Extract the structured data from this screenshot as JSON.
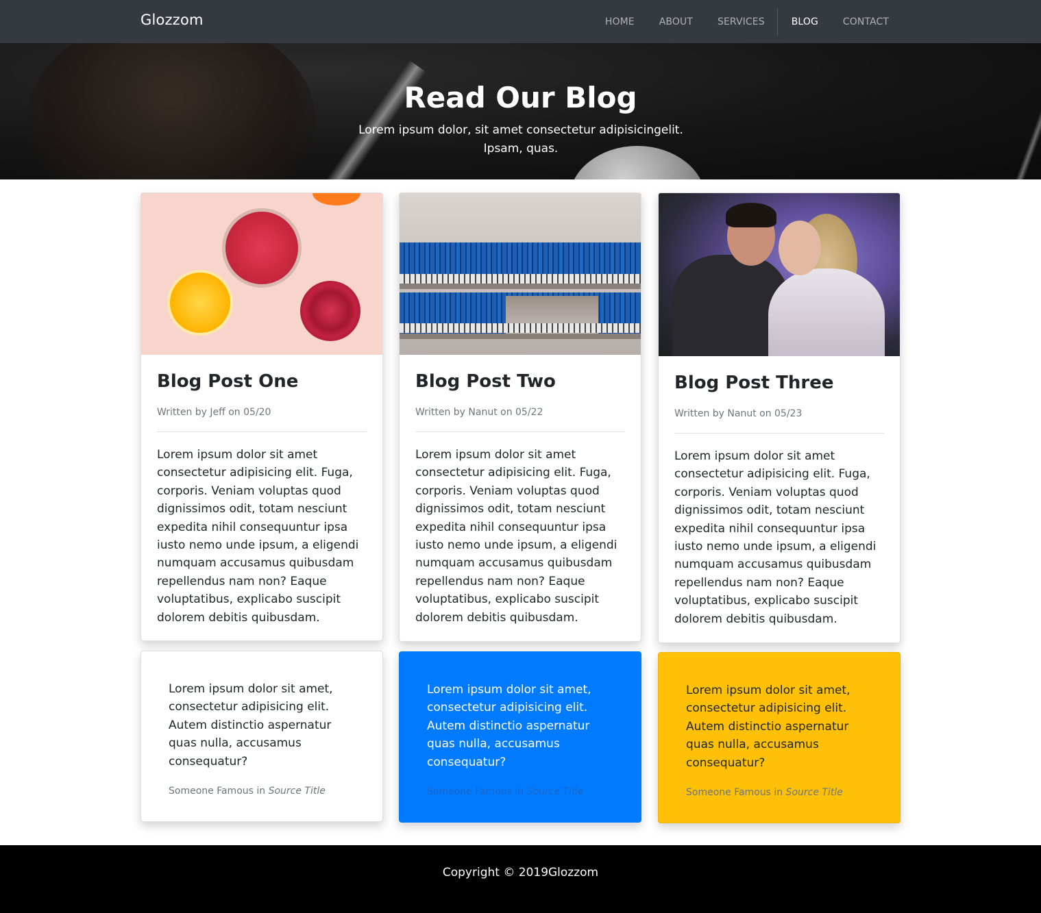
{
  "navbar": {
    "brand": "Glozzom",
    "links": [
      {
        "label": "HOME",
        "active": false
      },
      {
        "label": "ABOUT",
        "active": false
      },
      {
        "label": "SERVICES",
        "active": false
      },
      {
        "label": "BLOG",
        "active": true
      },
      {
        "label": "CONTACT",
        "active": false
      }
    ]
  },
  "hero": {
    "title": "Read Our Blog",
    "subtitle": "Lorem ipsum dolor, sit amet consectetur adipisicingelit. Ipsam, quas."
  },
  "posts": [
    {
      "title": "Blog Post One",
      "meta": "Written by Jeff on 05/20",
      "image": "fruits-photo",
      "body": "Lorem ipsum dolor sit amet consectetur adipisicing elit. Fuga, corporis. Veniam voluptas quod dignissimos odit, totam nesciunt expedita nihil consequuntur ipsa iusto nemo unde ipsum, a eligendi numquam accusamus quibusdam repellendus nam non? Eaque voluptatibus, explicabo suscipit dolorem debitis quibusdam."
    },
    {
      "title": "Blog Post Two",
      "meta": "Written by Nanut on 05/22",
      "image": "library-photo",
      "body": "Lorem ipsum dolor sit amet consectetur adipisicing elit. Fuga, corporis. Veniam voluptas quod dignissimos odit, totam nesciunt expedita nihil consequuntur ipsa iusto nemo unde ipsum, a eligendi numquam accusamus quibusdam repellendus nam non? Eaque voluptatibus, explicabo suscipit dolorem debitis quibusdam."
    },
    {
      "title": "Blog Post Three",
      "meta": "Written by Nanut on 05/23",
      "image": "couple-photo",
      "body": "Lorem ipsum dolor sit amet consectetur adipisicing elit. Fuga, corporis. Veniam voluptas quod dignissimos odit, totam nesciunt expedita nihil consequuntur ipsa iusto nemo unde ipsum, a eligendi numquam accusamus quibusdam repellendus nam non? Eaque voluptatibus, explicabo suscipit dolorem debitis quibusdam."
    }
  ],
  "quotes": [
    {
      "text": "Lorem ipsum dolor sit amet, consectetur adipisicing elit. Autem distinctio aspernatur quas nulla, accusamus consequatur?",
      "author": "Someone Famous in",
      "source": "Source Title",
      "color": "#ffffff"
    },
    {
      "text": "Lorem ipsum dolor sit amet, consectetur adipisicing elit. Autem distinctio aspernatur quas nulla, accusamus consequatur?",
      "author": "Someone Famous in",
      "source": "Source Title",
      "color": "#007bff"
    },
    {
      "text": "Lorem ipsum dolor sit amet, consectetur adipisicing elit. Autem distinctio aspernatur quas nulla, accusamus consequatur?",
      "author": "Someone Famous in",
      "source": "Source Title",
      "color": "#ffc107"
    }
  ],
  "footer": {
    "copyright": "Copyright © 2019Glozzom"
  }
}
